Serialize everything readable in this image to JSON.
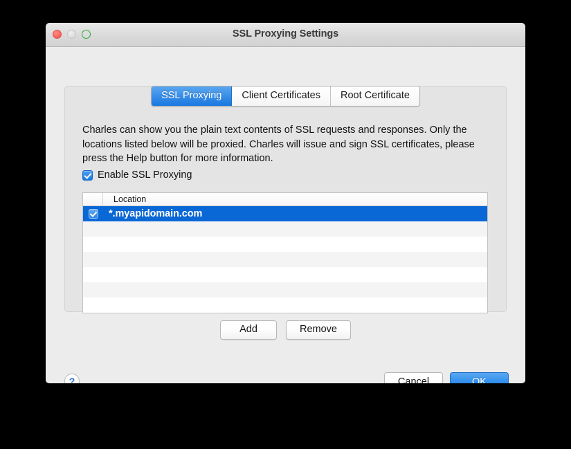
{
  "window": {
    "title": "SSL Proxying Settings",
    "traffic_lights": [
      {
        "name": "close",
        "color": "#f9625a"
      },
      {
        "name": "minimize",
        "color": "#dcdcdc"
      },
      {
        "name": "zoom",
        "color": "#2ec840"
      }
    ]
  },
  "tabs": [
    {
      "label": "SSL Proxying",
      "selected": true
    },
    {
      "label": "Client Certificates",
      "selected": false
    },
    {
      "label": "Root Certificate",
      "selected": false
    }
  ],
  "panel": {
    "description": "Charles can show you the plain text contents of SSL requests and responses. Only the locations listed below will be proxied. Charles will issue and sign SSL certificates, please press the Help button for more information.",
    "enable_checkbox": {
      "label": "Enable SSL Proxying",
      "checked": true
    },
    "table": {
      "columns": [
        "",
        "Location"
      ],
      "rows": [
        {
          "checked": true,
          "location": "*.myapidomain.com",
          "selected": true
        }
      ],
      "empty_row_count": 6
    },
    "list_buttons": {
      "add_label": "Add",
      "remove_label": "Remove"
    }
  },
  "footer": {
    "help_label": "?",
    "cancel_label": "Cancel",
    "ok_label": "OK"
  },
  "colors": {
    "accent_blue": "#1878e0",
    "selection_blue": "#0a67d6",
    "window_bg": "#ececec",
    "panel_bg": "#e4e4e4"
  }
}
